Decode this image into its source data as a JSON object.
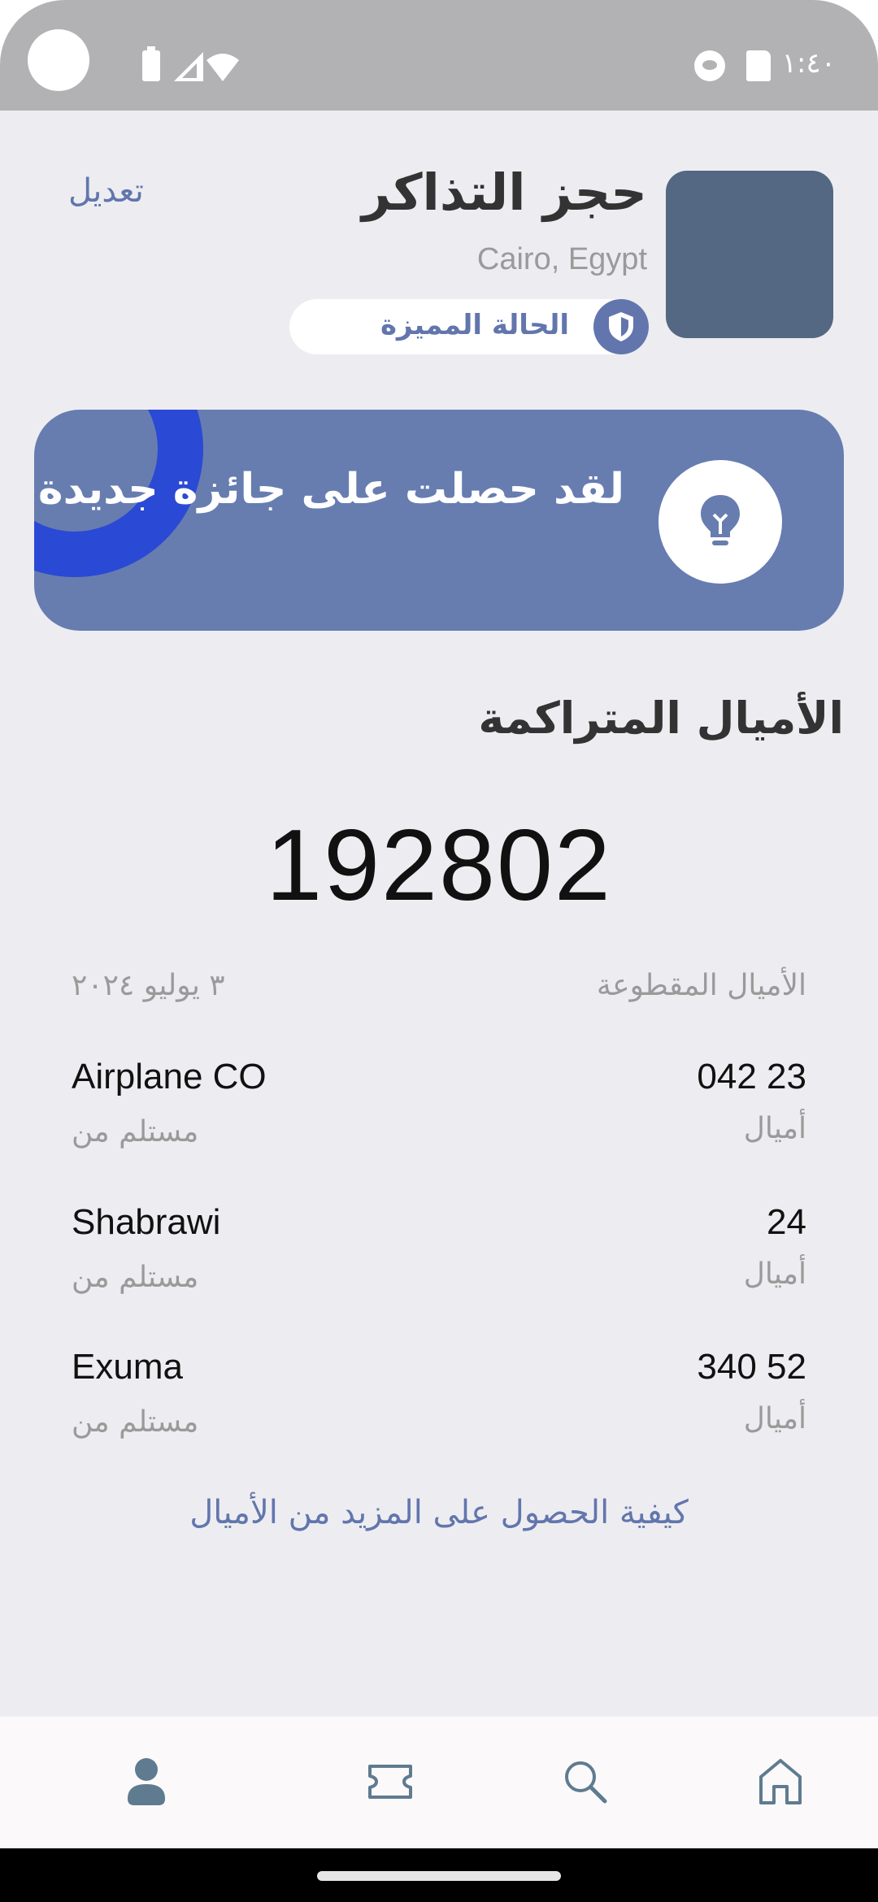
{
  "status_bar": {
    "time": "١:٤٠"
  },
  "profile": {
    "title": "حجز التذاكر",
    "location": "Cairo, Egypt",
    "edit_label": "تعديل",
    "status_label": "الحالة المميزة"
  },
  "reward": {
    "text": "لقد حصلت على جائزة جديدة"
  },
  "miles": {
    "title": "الأميال المتراكمة",
    "total": "192802",
    "cut_label": "الأميال المقطوعة",
    "cut_date": "٣ يوليو ٢٠٢٤"
  },
  "transactions": [
    {
      "source": "Airplane CO",
      "source_label": "مستلم من",
      "amount": "042 23",
      "unit": "أميال"
    },
    {
      "source": "Shabrawi",
      "source_label": "مستلم من",
      "amount": "24",
      "unit": "أميال"
    },
    {
      "source": "Exuma",
      "source_label": "مستلم من",
      "amount": "340 52",
      "unit": "أميال"
    }
  ],
  "more_link": "كيفية الحصول على المزيد من الأميال",
  "nav": {
    "items": [
      "profile-icon",
      "ticket-icon",
      "search-icon",
      "home-icon"
    ],
    "active": "profile-icon"
  },
  "colors": {
    "accent": "#6276ad",
    "banner": "#677db0",
    "ring": "#2a49d4",
    "avatar": "#546783",
    "background": "#ededf1"
  }
}
